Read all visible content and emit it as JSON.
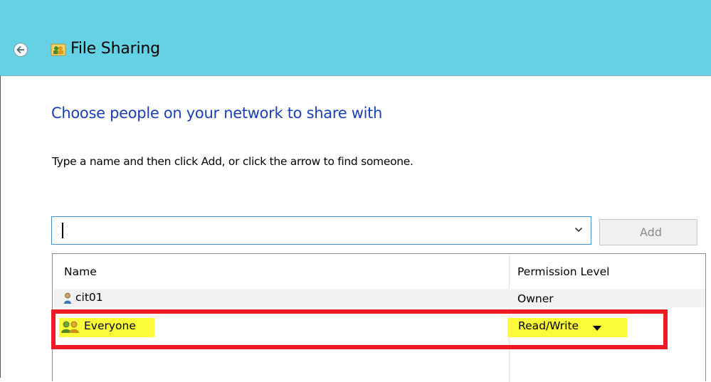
{
  "window": {
    "title": "File Sharing"
  },
  "content": {
    "heading": "Choose people on your network to share with",
    "instruction": "Type a name and then click Add, or click the arrow to find someone.",
    "name_input": {
      "value": "",
      "placeholder": ""
    },
    "add_button_label": "Add"
  },
  "table": {
    "columns": [
      "Name",
      "Permission Level"
    ],
    "rows": [
      {
        "name": "cit01",
        "permission": "Owner",
        "icon": "user-icon"
      },
      {
        "name": "Everyone",
        "permission": "Read/Write",
        "icon": "group-icon"
      }
    ]
  },
  "colors": {
    "titlebar": "#64d2e4",
    "heading": "#1a3fb5",
    "highlight": "#fbfb3a",
    "annotation_box": "#ec1b24"
  }
}
